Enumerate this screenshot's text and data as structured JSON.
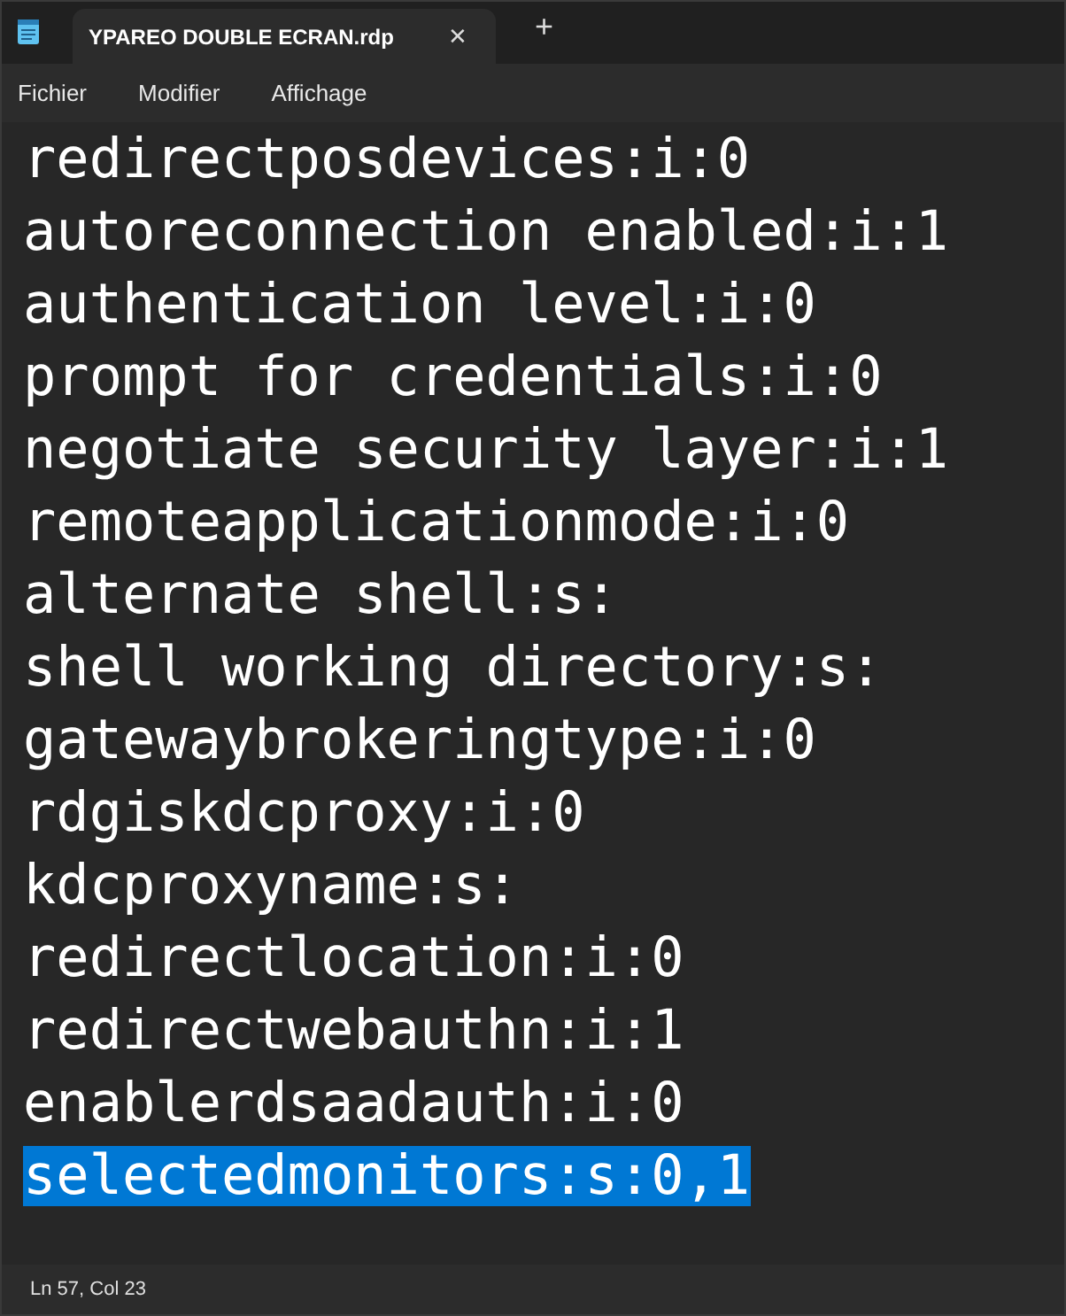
{
  "tabs": [
    {
      "title": "YPAREO DOUBLE ECRAN.rdp",
      "close": "✕",
      "selected": true
    }
  ],
  "new_tab": "+",
  "menu": [
    "Fichier",
    "Modifier",
    "Affichage"
  ],
  "lines": [
    {
      "text": "redirectposdevices:i:0",
      "selected": false
    },
    {
      "text": "autoreconnection enabled:i:1",
      "selected": false
    },
    {
      "text": "authentication level:i:0",
      "selected": false
    },
    {
      "text": "prompt for credentials:i:0",
      "selected": false
    },
    {
      "text": "negotiate security layer:i:1",
      "selected": false
    },
    {
      "text": "remoteapplicationmode:i:0",
      "selected": false
    },
    {
      "text": "alternate shell:s:",
      "selected": false
    },
    {
      "text": "shell working directory:s:",
      "selected": false
    },
    {
      "text": "gatewaybrokeringtype:i:0",
      "selected": false
    },
    {
      "text": "rdgiskdcproxy:i:0",
      "selected": false
    },
    {
      "text": "kdcproxyname:s:",
      "selected": false
    },
    {
      "text": "redirectlocation:i:0",
      "selected": false
    },
    {
      "text": "redirectwebauthn:i:1",
      "selected": false
    },
    {
      "text": "enablerdsaadauth:i:0",
      "selected": false
    },
    {
      "text": "selectedmonitors:s:0,1",
      "selected": true
    }
  ],
  "status_bar": {
    "position": "Ln 57, Col 23"
  }
}
